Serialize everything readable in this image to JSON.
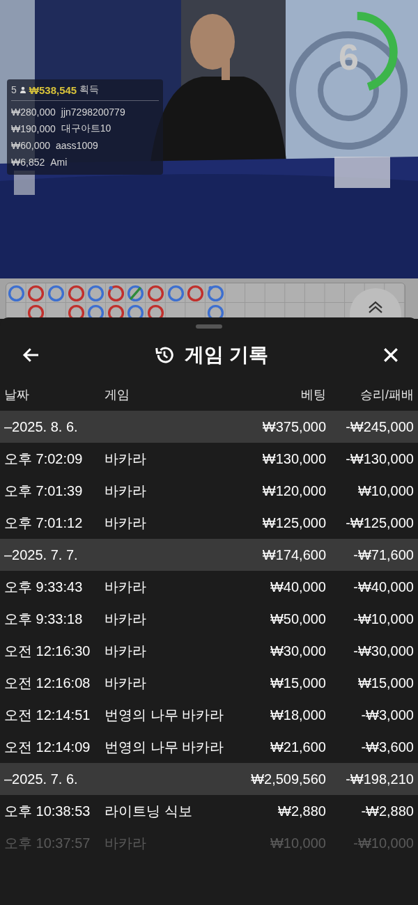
{
  "stream": {
    "timer": {
      "value": "6",
      "level": 0.45
    },
    "winners": {
      "count": "5",
      "total": "₩538,545",
      "label": "획득",
      "bets": [
        {
          "amount": "₩280,000",
          "name": "jjn7298200779"
        },
        {
          "amount": "₩190,000",
          "name": "대구아트10"
        },
        {
          "amount": "₩60,000",
          "name": "aass1009"
        },
        {
          "amount": "₩6,852",
          "name": "Ami"
        }
      ]
    }
  },
  "roadmap": {
    "rows": [
      [
        {
          "kind": "ring",
          "color": "#3d6fcf",
          "pair": false,
          "tie": false
        },
        {
          "kind": "ring",
          "color": "#c0302c",
          "pair": false,
          "tie": false
        },
        {
          "kind": "ring",
          "color": "#3d6fcf",
          "pair": false,
          "tie": false
        },
        {
          "kind": "ring",
          "color": "#c0302c",
          "pair": false,
          "tie": false
        },
        {
          "kind": "ring",
          "color": "#3d6fcf",
          "pair": false,
          "tie": false
        },
        {
          "kind": "ring",
          "color": "#c0302c",
          "pair": true,
          "tie": false
        },
        {
          "kind": "ring",
          "color": "#3d6fcf",
          "pair": false,
          "tie": true
        },
        {
          "kind": "ring",
          "color": "#c0302c",
          "pair": false,
          "tie": false
        },
        {
          "kind": "ring",
          "color": "#3d6fcf",
          "pair": false,
          "tie": false
        },
        {
          "kind": "ring",
          "color": "#c0302c",
          "pair": false,
          "tie": false
        },
        {
          "kind": "ring",
          "color": "#3d6fcf",
          "pair": true,
          "tie": false
        }
      ],
      [
        {
          "kind": "empty"
        },
        {
          "kind": "ring",
          "color": "#c0302c",
          "pair": false,
          "tie": false
        },
        {
          "kind": "empty"
        },
        {
          "kind": "ring",
          "color": "#c0302c",
          "pair": false,
          "tie": false
        },
        {
          "kind": "ring",
          "color": "#3d6fcf",
          "pair": false,
          "tie": false
        },
        {
          "kind": "ring",
          "color": "#c0302c",
          "pair": false,
          "tie": false
        },
        {
          "kind": "ring",
          "color": "#3d6fcf",
          "pair": false,
          "tie": false
        },
        {
          "kind": "ring",
          "color": "#c0302c",
          "pair": false,
          "tie": false
        },
        {
          "kind": "empty"
        },
        {
          "kind": "empty"
        },
        {
          "kind": "ring",
          "color": "#3d6fcf",
          "pair": false,
          "tie": false
        }
      ]
    ]
  },
  "sheet": {
    "title": "게임 기록",
    "columns": [
      "날짜",
      "게임",
      "베팅",
      "승리/패배"
    ],
    "rows": [
      {
        "kind": "date",
        "date": "–2025. 8. 6.",
        "bet": "₩375,000",
        "result": "-₩245,000",
        "dimmed": false
      },
      {
        "kind": "entry",
        "time": "오후 7:02:09",
        "game": "바카라",
        "bet": "₩130,000",
        "result": "-₩130,000",
        "dimmed": false
      },
      {
        "kind": "entry",
        "time": "오후 7:01:39",
        "game": "바카라",
        "bet": "₩120,000",
        "result": "₩10,000",
        "dimmed": false
      },
      {
        "kind": "entry",
        "time": "오후 7:01:12",
        "game": "바카라",
        "bet": "₩125,000",
        "result": "-₩125,000",
        "dimmed": false
      },
      {
        "kind": "date",
        "date": "–2025. 7. 7.",
        "bet": "₩174,600",
        "result": "-₩71,600",
        "dimmed": false
      },
      {
        "kind": "entry",
        "time": "오후 9:33:43",
        "game": "바카라",
        "bet": "₩40,000",
        "result": "-₩40,000",
        "dimmed": false
      },
      {
        "kind": "entry",
        "time": "오후 9:33:18",
        "game": "바카라",
        "bet": "₩50,000",
        "result": "-₩10,000",
        "dimmed": false
      },
      {
        "kind": "entry",
        "time": "오전 12:16:30",
        "game": "바카라",
        "bet": "₩30,000",
        "result": "-₩30,000",
        "dimmed": false
      },
      {
        "kind": "entry",
        "time": "오전 12:16:08",
        "game": "바카라",
        "bet": "₩15,000",
        "result": "₩15,000",
        "dimmed": false
      },
      {
        "kind": "entry",
        "time": "오전 12:14:51",
        "game": "번영의 나무 바카라",
        "bet": "₩18,000",
        "result": "-₩3,000",
        "dimmed": false
      },
      {
        "kind": "entry",
        "time": "오전 12:14:09",
        "game": "번영의 나무 바카라",
        "bet": "₩21,600",
        "result": "-₩3,600",
        "dimmed": false
      },
      {
        "kind": "date",
        "date": "–2025. 7. 6.",
        "bet": "₩2,509,560",
        "result": "-₩198,210",
        "dimmed": false
      },
      {
        "kind": "entry",
        "time": "오후 10:38:53",
        "game": "라이트닝 식보",
        "bet": "₩2,880",
        "result": "-₩2,880",
        "dimmed": false
      },
      {
        "kind": "entry",
        "time": "오후 10:37:57",
        "game": "바카라",
        "bet": "₩10,000",
        "result": "-₩10,000",
        "dimmed": true
      }
    ]
  }
}
